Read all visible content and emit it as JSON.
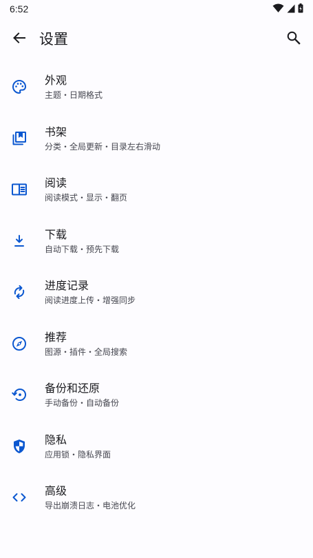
{
  "status_bar": {
    "time": "6:52",
    "icons": [
      "wifi-icon",
      "cellular-signal-icon",
      "battery-icon"
    ]
  },
  "app_bar": {
    "title": "设置",
    "back_icon": "arrow-back-icon",
    "search_icon": "search-icon"
  },
  "colors": {
    "accent": "#0b57d0",
    "background": "#fdfcff",
    "text_primary": "#1b1b1f",
    "text_secondary": "#45464f"
  },
  "settings": [
    {
      "icon": "palette-icon",
      "title": "外观",
      "summary": "主题・日期格式"
    },
    {
      "icon": "bookshelf-icon",
      "title": "书架",
      "summary": "分类・全局更新・目录左右滑动"
    },
    {
      "icon": "reader-icon",
      "title": "阅读",
      "summary": "阅读模式・显示・翻页"
    },
    {
      "icon": "download-icon",
      "title": "下载",
      "summary": "自动下载・预先下载"
    },
    {
      "icon": "sync-icon",
      "title": "进度记录",
      "summary": "阅读进度上传・增强同步"
    },
    {
      "icon": "compass-icon",
      "title": "推荐",
      "summary": "图源・插件・全局搜索"
    },
    {
      "icon": "backup-restore-icon",
      "title": "备份和还原",
      "summary": "手动备份・自动备份"
    },
    {
      "icon": "privacy-shield-icon",
      "title": "隐私",
      "summary": "应用锁・隐私界面"
    },
    {
      "icon": "code-icon",
      "title": "高级",
      "summary": "导出崩溃日志・电池优化"
    }
  ]
}
